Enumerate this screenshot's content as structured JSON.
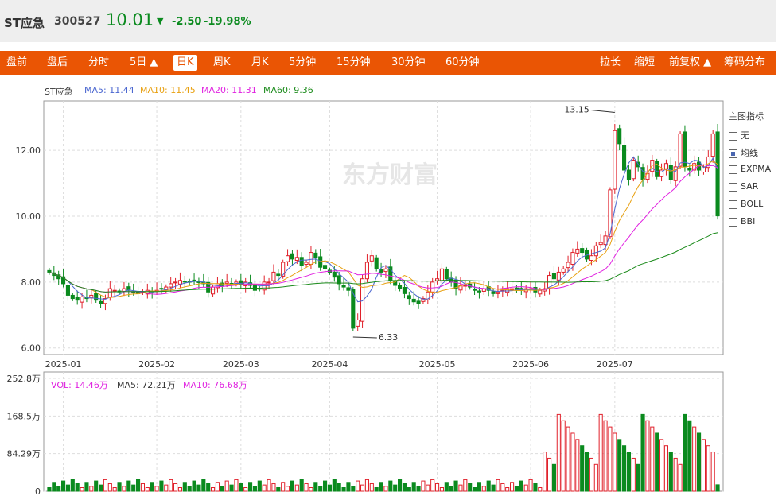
{
  "quote": {
    "name": "ST应急",
    "code": "300527",
    "price": "10.01",
    "arrow": "▼",
    "change": "-2.50",
    "change_pct": "-19.98%"
  },
  "toolbar": {
    "left_tabs": [
      "盘前",
      "盘后",
      "分时",
      "5日 ▲",
      "日K",
      "周K",
      "月K",
      "5分钟",
      "15分钟",
      "30分钟",
      "60分钟"
    ],
    "active": "日K",
    "right_tabs": [
      "拉长",
      "缩短",
      "前复权 ▲",
      "筹码分布"
    ]
  },
  "main_legend": {
    "name": "ST应急",
    "ma5": "MA5: 11.44",
    "ma10": "MA10: 11.45",
    "ma20": "MA20: 11.31",
    "ma60": "MA60: 9.36"
  },
  "indicator_panel": {
    "title": "主图指标",
    "options": [
      "无",
      "均线",
      "EXPMA",
      "SAR",
      "BOLL",
      "BBI"
    ],
    "selected": "均线"
  },
  "vol_legend": {
    "vol": "VOL: 14.46万",
    "ma5": "MA5: 72.21万",
    "ma10": "MA10: 76.68万"
  },
  "colors": {
    "up": "#e0202a",
    "down": "#0a8a1e",
    "ma5": "#4a66d0",
    "ma10": "#e8a010",
    "ma20": "#e020e0",
    "ma60": "#1a8a1a",
    "accent": "#ea5504"
  },
  "watermark": "东方财富",
  "chart_data": [
    {
      "type": "candlestick",
      "y_ticks": [
        "12.00",
        "10.00",
        "8.00",
        "6.00"
      ],
      "ylim": [
        5.8,
        13.5
      ],
      "x_ticks": [
        "2025-01",
        "2025-02",
        "2025-03",
        "2025-04",
        "2025-05",
        "2025-06",
        "2025-07"
      ],
      "annotations": [
        {
          "label": "13.15",
          "value": 13.15
        },
        {
          "label": "6.33",
          "value": 6.33
        }
      ],
      "closes": [
        8.3,
        8.2,
        8.1,
        7.95,
        7.6,
        7.5,
        7.45,
        7.55,
        7.5,
        7.6,
        7.45,
        7.35,
        7.5,
        7.8,
        7.75,
        7.7,
        7.8,
        7.75,
        7.7,
        7.65,
        7.7,
        7.75,
        7.7,
        7.75,
        7.8,
        7.85,
        7.95,
        8.0,
        8.05,
        8.0,
        8.0,
        8.05,
        8.0,
        7.95,
        7.7,
        7.85,
        7.95,
        7.9,
        8.0,
        7.95,
        8.0,
        7.95,
        8.0,
        7.9,
        7.75,
        7.8,
        8.0,
        8.0,
        8.3,
        8.2,
        8.6,
        8.8,
        8.7,
        8.75,
        8.5,
        8.6,
        8.9,
        8.75,
        8.45,
        8.4,
        8.3,
        8.15,
        7.95,
        7.85,
        7.75,
        6.6,
        6.85,
        8.1,
        8.6,
        8.8,
        8.4,
        8.3,
        8.4,
        8.05,
        7.9,
        7.8,
        7.65,
        7.5,
        7.4,
        7.35,
        7.5,
        7.7,
        8.0,
        8.1,
        8.4,
        8.1,
        8.0,
        7.8,
        7.9,
        7.9,
        7.85,
        7.75,
        7.7,
        7.8,
        7.75,
        7.65,
        7.7,
        7.75,
        7.8,
        7.8,
        7.75,
        7.75,
        7.8,
        7.8,
        7.7,
        7.75,
        7.8,
        8.2,
        8.1,
        8.3,
        8.4,
        8.6,
        8.9,
        9.0,
        8.9,
        8.7,
        8.8,
        9.1,
        9.2,
        9.4,
        10.8,
        12.6,
        12.2,
        11.4,
        11.1,
        11.7,
        11.5,
        11.1,
        11.3,
        11.7,
        11.2,
        11.4,
        11.6,
        11.1,
        11.5,
        12.5,
        11.5,
        11.4,
        11.6,
        11.4,
        11.5,
        11.8,
        12.5,
        10.01
      ],
      "ma5": [
        11.44
      ],
      "ma10": [
        11.45
      ],
      "ma20": [
        11.31
      ],
      "ma60": [
        9.36
      ]
    },
    {
      "type": "bar",
      "y_ticks": [
        "252.8万",
        "168.5万",
        "84.29万",
        "0"
      ],
      "ylim": [
        0,
        252.8
      ],
      "values": [
        14.46
      ]
    }
  ]
}
